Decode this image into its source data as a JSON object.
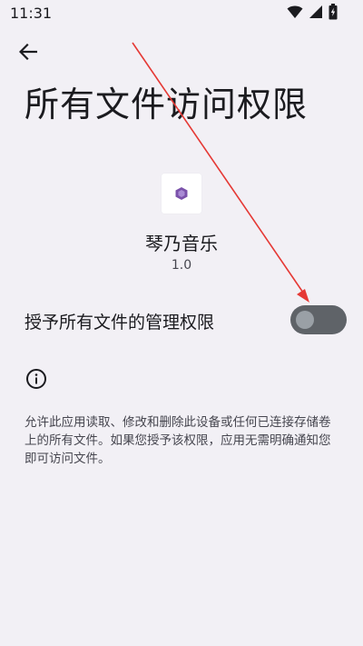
{
  "status_bar": {
    "time": "11:31",
    "icons": [
      "wifi-icon",
      "signal-icon",
      "battery-icon"
    ]
  },
  "header": {
    "title": "所有文件访问权限"
  },
  "app": {
    "name": "琴乃音乐",
    "version": "1.0",
    "icon": "app-icon"
  },
  "permission": {
    "label": "授予所有文件的管理权限",
    "enabled": false
  },
  "info": {
    "description": "允许此应用读取、修改和删除此设备或任何已连接存储卷上的所有文件。如果您授予该权限，应用无需明确通知您即可访问文件。"
  },
  "colors": {
    "background": "#f2f0f5",
    "toggle_track": "#5f6368",
    "toggle_thumb": "#9aa0a6",
    "annotation_arrow": "#e53935",
    "app_icon_accent": "#7b52ab"
  }
}
